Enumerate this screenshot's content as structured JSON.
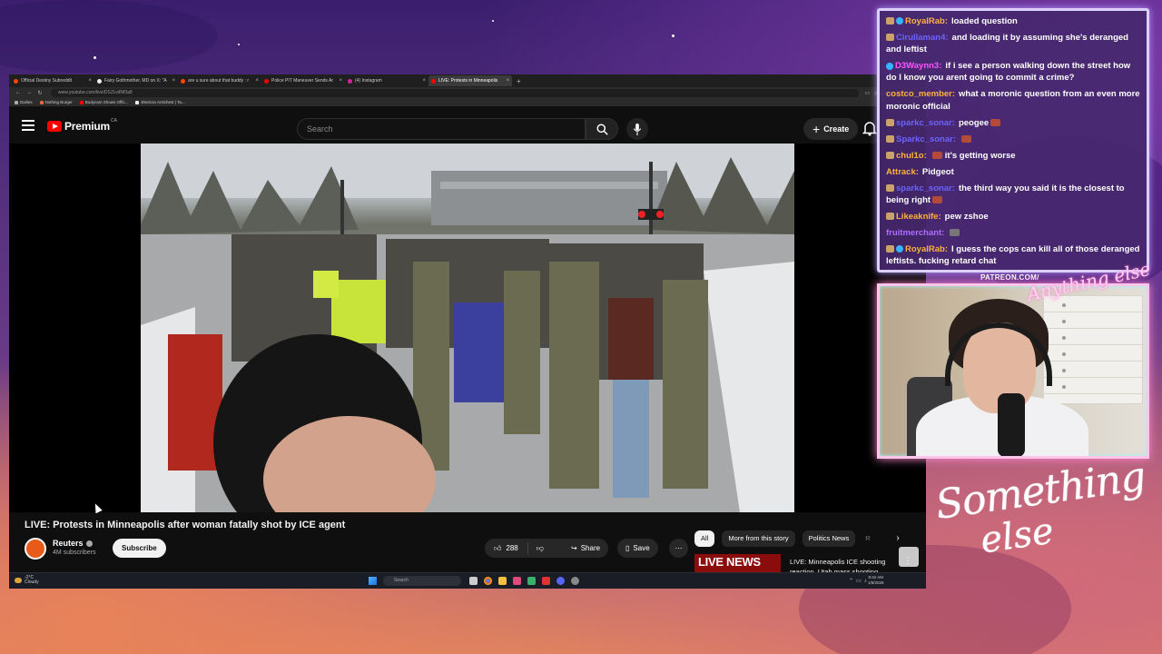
{
  "browser": {
    "tabs": [
      {
        "label": "Official Destiny Subreddit",
        "color": "#ff4500"
      },
      {
        "label": "Fairy Gothmother, MD on X: \"A",
        "color": "#eeeeee"
      },
      {
        "label": "are u sure about that buddy : r",
        "color": "#ff4500"
      },
      {
        "label": "Police PIT Maneuver Sends Ar",
        "color": "#ff0000"
      },
      {
        "label": "(4) Instagram",
        "color": "#d6249f"
      },
      {
        "label": "LIVE: Protests in Minneapolis",
        "color": "#ff0000"
      }
    ],
    "new_tab": "+",
    "url": "www.youtube.com/live/DSJ1vdNf3a8",
    "zoom": "150%",
    "bookmarks": [
      {
        "label": "Dailies",
        "color": "#aaaaaa"
      },
      {
        "label": "Nothing Burger",
        "color": "#e8663a"
      },
      {
        "label": "Bodycam Shows Offic...",
        "color": "#ff0000"
      },
      {
        "label": "Electron Antichest | Ta...",
        "color": "#eeeeee"
      }
    ]
  },
  "youtube": {
    "brand": "Premium",
    "region": "CA",
    "search_placeholder": "Search",
    "create_label": "Create",
    "video_title": "LIVE: Protests in Minneapolis after woman fatally shot by ICE agent",
    "channel_name": "Reuters",
    "subscribers": "4M subscribers",
    "subscribe_label": "Subscribe",
    "likes": "288",
    "share_label": "Share",
    "save_label": "Save",
    "chips": [
      "All",
      "More from this story",
      "Politics News",
      "R"
    ],
    "recommended": {
      "thumb_text": "LIVE NEWS",
      "title": "LIVE: Minneapolis ICE shooting reaction, Utah mass shooting"
    },
    "watermark": "Reuters"
  },
  "taskbar": {
    "weather_temp": "-2°C",
    "weather_desc": "Cloudy",
    "search_label": "Search",
    "time": "9:42 AM",
    "date": "1/8/2026"
  },
  "chat": {
    "messages": [
      {
        "user": "RoyalRab:",
        "color": "#ffb23c",
        "text": "loaded question",
        "badge": "both"
      },
      {
        "user": "Cirullaman4:",
        "color": "#6b63ff",
        "text": "and loading it by assuming she's deranged and leftist",
        "badge": "one"
      },
      {
        "user": "D3Waynn3:",
        "color": "#ff55ff",
        "text": "if i see a person walking down the street how do I know you arent going to commit a crime?",
        "badge": "blue"
      },
      {
        "user": "costco_member:",
        "color": "#ffb23c",
        "text": "what a moronic question from an even more moronic official",
        "badge": "none"
      },
      {
        "user": "sparkc_sonar:",
        "color": "#6b63ff",
        "text": "peogee",
        "badge": "one",
        "emote": true
      },
      {
        "user": "Sparkc_sonar:",
        "color": "#6b63ff",
        "text": "",
        "badge": "one",
        "emote": true
      },
      {
        "user": "chul1o:",
        "color": "#ffb23c",
        "text": "it's getting worse",
        "badge": "one",
        "emote_before": true
      },
      {
        "user": "Attrack:",
        "color": "#ffb23c",
        "text": "Pidgeot",
        "badge": "none"
      },
      {
        "user": "sparkc_sonar:",
        "color": "#6b63ff",
        "text": "the third way you said it is the closest to being right",
        "badge": "one",
        "emote": true
      },
      {
        "user": "Likeaknife:",
        "color": "#ffb23c",
        "text": "pew zshoe",
        "badge": "one"
      },
      {
        "user": "fruitmerchant:",
        "color": "#b06bff",
        "text": "",
        "badge": "none",
        "emote": true
      },
      {
        "user": "RoyalRab:",
        "color": "#ffb23c",
        "text": "I guess the cops can kill all of those deranged leftists. fucking retard chat",
        "badge": "both"
      }
    ]
  },
  "overlay": {
    "patreon": "PATREON.COM/",
    "anything_logo": "Anything else",
    "logo_line1": "Something",
    "logo_line2": "else"
  }
}
